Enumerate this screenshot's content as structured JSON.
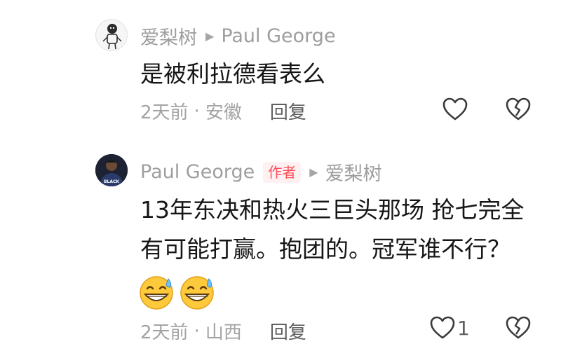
{
  "comments": [
    {
      "author": "爱梨树",
      "reply_to": "Paul George",
      "text": "是被利拉德看表么",
      "time": "2天前",
      "separator": "·",
      "location": "安徽",
      "reply_label": "回复",
      "like_count": "",
      "avatar_icon": "sketch-figure-avatar",
      "like_icon": "heart-outline-icon",
      "dislike_icon": "broken-heart-icon"
    },
    {
      "author": "Paul George",
      "author_tag": "作者",
      "reply_to": "爱梨树",
      "text_lines": [
        "13年东决和热火三巨头那场 抢七完全",
        "有可能打赢。抱团的。冠军谁不行？"
      ],
      "emojis": [
        "sweat-grin-emoji",
        "sweat-grin-emoji"
      ],
      "time": "2天前",
      "separator": "·",
      "location": "山西",
      "reply_label": "回复",
      "like_count": "1",
      "avatar_text": "BLACK",
      "avatar_icon": "player-photo-avatar",
      "like_icon": "heart-outline-icon",
      "dislike_icon": "broken-heart-icon"
    }
  ],
  "colors": {
    "meta_gray": "#9e9e9e",
    "text_black": "#161616",
    "tag_red": "#ff4d5b",
    "tag_bg": "#fff1f2"
  }
}
